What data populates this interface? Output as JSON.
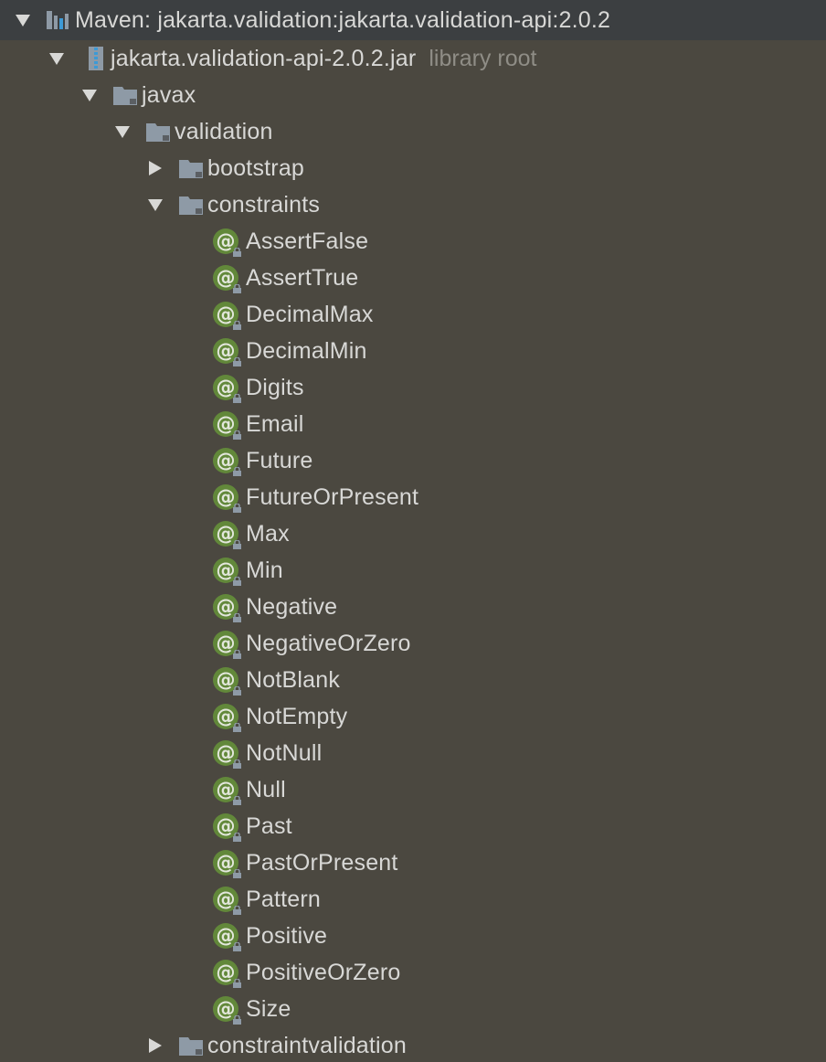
{
  "tree": {
    "root": {
      "label": "Maven: jakarta.validation:jakarta.validation-api:2.0.2",
      "icon": "maven-library-icon"
    },
    "jar": {
      "label": "jakarta.validation-api-2.0.2.jar",
      "hint": "library root",
      "icon": "jar-archive-icon"
    },
    "packages": {
      "javax": "javax",
      "validation": "validation",
      "bootstrap": "bootstrap",
      "constraints": "constraints",
      "constraintvalidation": "constraintvalidation"
    },
    "annotations": [
      "AssertFalse",
      "AssertTrue",
      "DecimalMax",
      "DecimalMin",
      "Digits",
      "Email",
      "Future",
      "FutureOrPresent",
      "Max",
      "Min",
      "Negative",
      "NegativeOrZero",
      "NotBlank",
      "NotEmpty",
      "NotNull",
      "Null",
      "Past",
      "PastOrPresent",
      "Pattern",
      "Positive",
      "PositiveOrZero",
      "Size"
    ],
    "colors": {
      "background": "#4b4840",
      "header_band": "#3c3f41",
      "text": "#d8d8d6",
      "hint_text": "#8f8d86",
      "annotation_icon": "#62883a",
      "folder_icon": "#8e9aa6"
    }
  }
}
